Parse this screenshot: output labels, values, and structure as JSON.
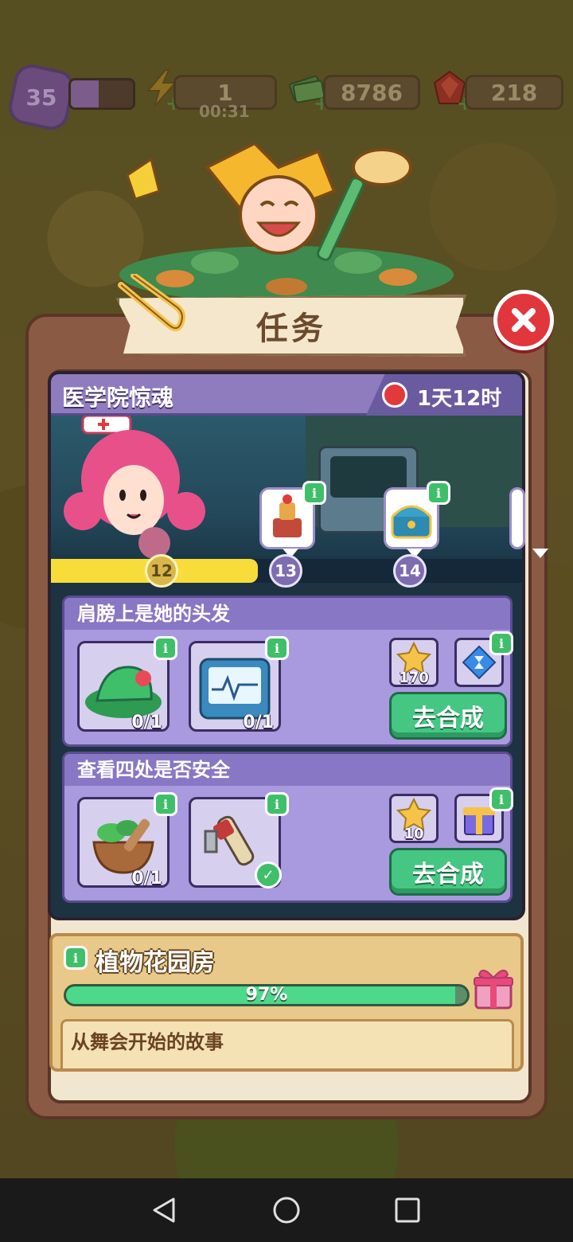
{
  "hud": {
    "level": "35",
    "energy": "1",
    "energy_timer": "00:31",
    "cash": "8786",
    "gems": "218"
  },
  "dialog": {
    "title": "任务"
  },
  "event": {
    "title": "医学院惊魂",
    "time_left": "1天12时",
    "progress": 0.44,
    "milestones": [
      "12",
      "13",
      "14"
    ]
  },
  "quests": [
    {
      "title": "肩膀上是她的头发",
      "items": [
        {
          "icon": "green-hat-icon",
          "count": "0/1",
          "complete": false
        },
        {
          "icon": "heart-monitor-icon",
          "count": "0/1",
          "complete": false
        }
      ],
      "rewards": [
        {
          "icon": "star-coin-icon",
          "count": "170"
        },
        {
          "icon": "hourglass-gem-icon",
          "count": ""
        }
      ],
      "button": "去合成"
    },
    {
      "title": "查看四处是否安全",
      "items": [
        {
          "icon": "herb-mortar-icon",
          "count": "0/1",
          "complete": false
        },
        {
          "icon": "tool-handle-icon",
          "count": "",
          "complete": true
        }
      ],
      "rewards": [
        {
          "icon": "star-coin-icon",
          "count": "10"
        },
        {
          "icon": "gift-box-icon",
          "count": ""
        }
      ],
      "button": "去合成"
    }
  ],
  "garden": {
    "title": "植物花园房",
    "progress_label": "97%",
    "progress": 0.97,
    "subtitle": "从舞会开始的故事"
  }
}
